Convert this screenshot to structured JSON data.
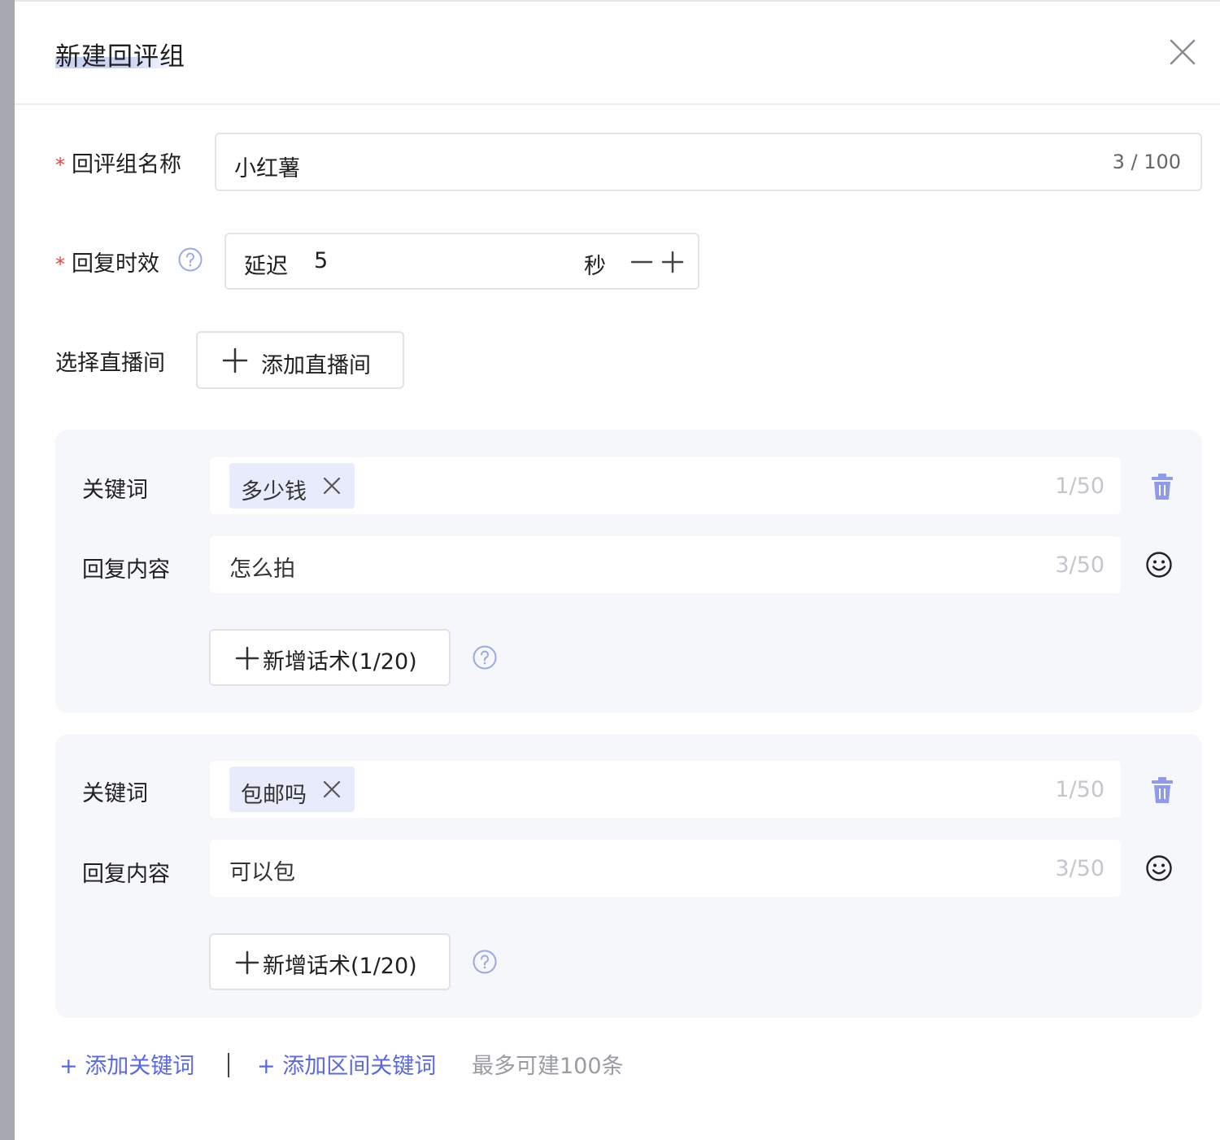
{
  "dialog": {
    "title": "新建回评组"
  },
  "form": {
    "required_mark": "*",
    "name_label": "回评组名称",
    "name_value": "小红薯",
    "name_count": "3 / 100",
    "timing_label": "回复时效",
    "timing_prefix": "延迟",
    "timing_value": "5",
    "timing_unit": "秒",
    "room_label": "选择直播间",
    "add_room_button": "添加直播间"
  },
  "rules": [
    {
      "keyword_label": "关键词",
      "keyword_tag": "多少钱",
      "keyword_count": "1/50",
      "reply_label": "回复内容",
      "reply_value": "怎么拍",
      "reply_count": "3/50",
      "add_script_button": "新增话术(1/20)"
    },
    {
      "keyword_label": "关键词",
      "keyword_tag": "包邮吗",
      "keyword_count": "1/50",
      "reply_label": "回复内容",
      "reply_value": "可以包",
      "reply_count": "3/50",
      "add_script_button": "新增话术(1/20)"
    }
  ],
  "footer": {
    "add_keyword_link": "+ 添加关键词",
    "separator": "|",
    "add_range_keyword_link": "+ 添加区间关键词",
    "limit_hint": "最多可建100条"
  },
  "colors": {
    "accent": "#5a68e6",
    "required": "#f0443a",
    "tag_bg": "#e8ebfb",
    "group_bg": "#f6f7fa"
  },
  "icons": [
    "close-icon",
    "help-icon",
    "minus-icon",
    "plus-icon",
    "trash-icon",
    "emoji-icon"
  ]
}
